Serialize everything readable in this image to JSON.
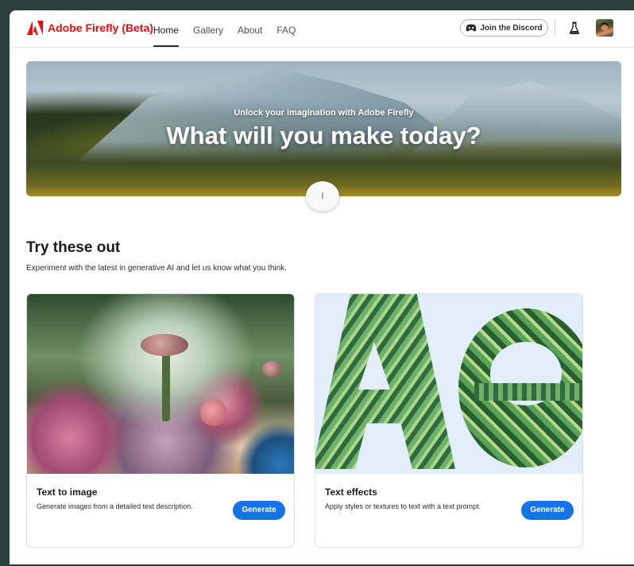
{
  "header": {
    "brand": "Adobe Firefly (Beta)",
    "nav": [
      "Home",
      "Gallery",
      "About",
      "FAQ"
    ],
    "active_nav": "Home",
    "discord_label": "Join the Discord"
  },
  "hero": {
    "subtitle": "Unlock your imagination with Adobe Firefly",
    "title": "What will you make today?",
    "scroll_glyph": "l"
  },
  "section": {
    "title": "Try these out",
    "description": "Experiment with the latest in generative AI and let us know what you think."
  },
  "cards": [
    {
      "title": "Text to image",
      "description": "Generate images from a detailed text description.",
      "button": "Generate"
    },
    {
      "title": "Text effects",
      "description": "Apply styles or textures to text with a text prompt.",
      "button": "Generate"
    }
  ],
  "colors": {
    "brand_red": "#e60e0e",
    "accent_blue": "#1473e6"
  },
  "icons": [
    "adobe-logo-icon",
    "discord-icon",
    "flask-icon",
    "avatar"
  ]
}
